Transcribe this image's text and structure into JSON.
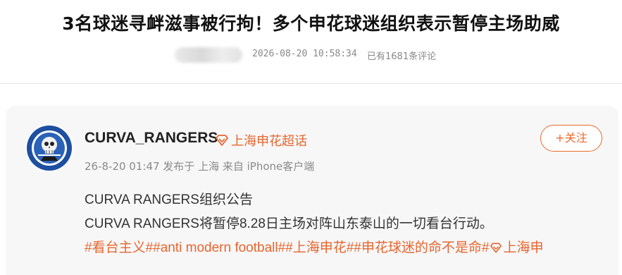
{
  "article": {
    "headline": "3名球迷寻衅滋事被行拘！多个申花球迷组织表示暂停主场助威",
    "datetime": "2026-08-20 10:58:34",
    "comment_count_text": "已有1681条评论"
  },
  "post": {
    "username": "CURVA_RANGERS",
    "topic_label": "上海申花超话",
    "follow_label": "+关注",
    "meta": "26-8-20 01:47 发布于 上海 来自 iPhone客户端",
    "line1": "CURVA RANGERS组织公告",
    "line2": "CURVA RANGERS将暂停8.28日主场对阵山东泰山的一切看台行动。",
    "tags": [
      "#看台主义#",
      "#anti modern football#",
      "#上海申花#",
      "#申花球迷的命不是命#"
    ],
    "trailing_text": "上海申"
  },
  "colors": {
    "accent": "#e8652e",
    "follow_border": "#ec6a2c",
    "meta_gray": "#8a8a8a",
    "text": "#333333"
  },
  "icons": {
    "topic": "diamond-topic-icon",
    "avatar": "skull-club-badge-icon"
  }
}
